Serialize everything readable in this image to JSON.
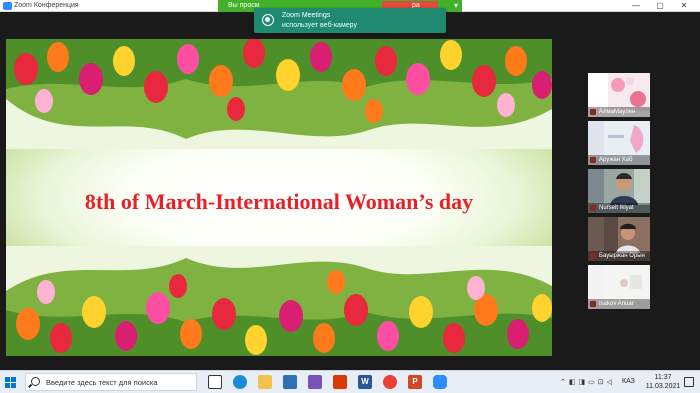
{
  "window": {
    "title": "Zoom Конференция",
    "share_banner_text": "Вы просм",
    "share_stop_text": "ра",
    "controls": [
      "—",
      "▢",
      "✕"
    ]
  },
  "notification": {
    "title": "Zoom Meetings",
    "body": "использует веб-камеру"
  },
  "slide": {
    "title": "8th of March-International Woman’s day"
  },
  "participants": [
    {
      "name": "АлмаМаулен"
    },
    {
      "name": "Аружан Хаб"
    },
    {
      "name": "Nurseit Ikiyat"
    },
    {
      "name": "Бауыржан Орын"
    },
    {
      "name": "Isakov Anuar"
    }
  ],
  "taskbar": {
    "search_placeholder": "Введите здесь текст для поиска",
    "language": "КАЗ",
    "time": "11:37",
    "date": "11.03.2021",
    "app_letters": [
      "W",
      "P"
    ]
  },
  "colors": {
    "title_red": "#e8202a",
    "share_green": "#43b02a",
    "notification_teal": "#1f8a70",
    "zoom_blue": "#2d8cff"
  }
}
